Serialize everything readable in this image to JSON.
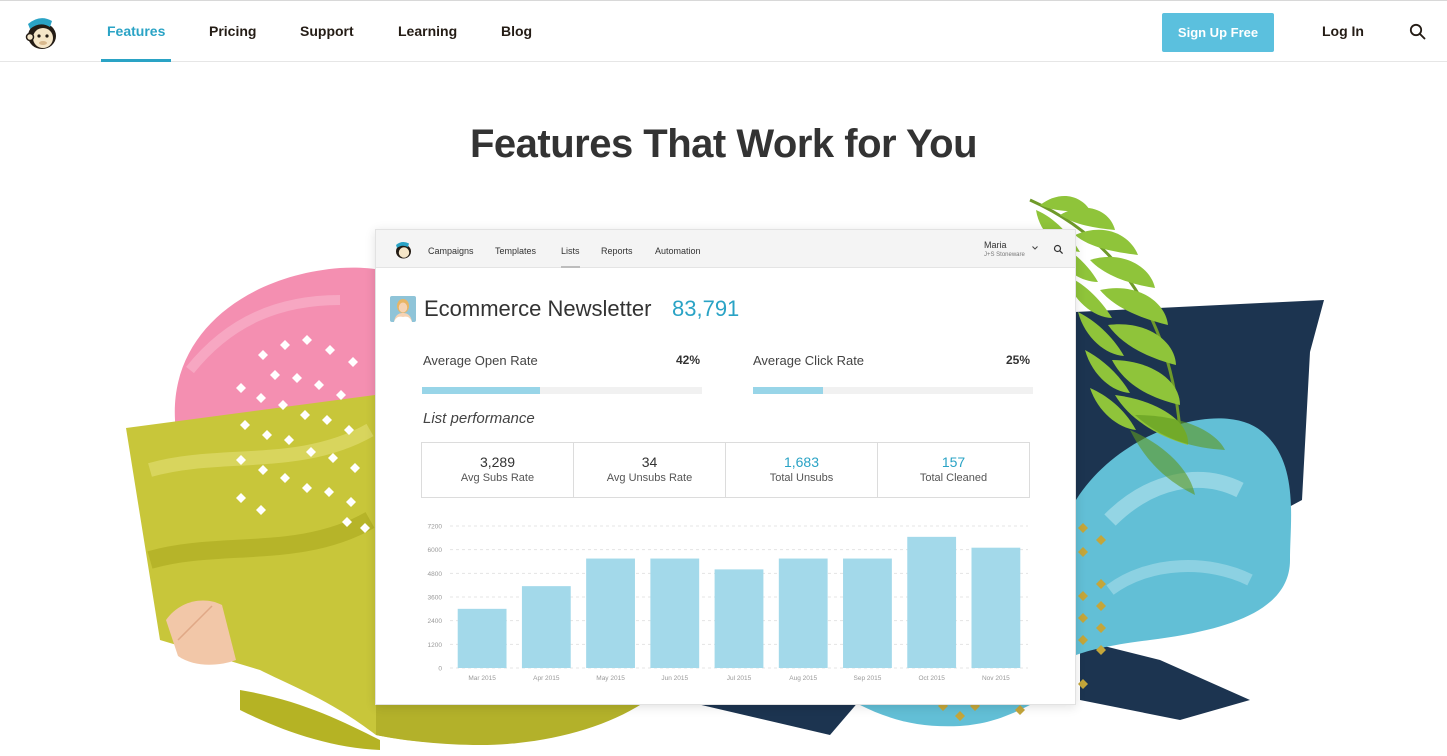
{
  "nav": {
    "links": [
      "Features",
      "Pricing",
      "Support",
      "Learning",
      "Blog"
    ],
    "active": "Features",
    "signup_label": "Sign Up Free",
    "login_label": "Log In"
  },
  "hero": {
    "title": "Features That Work for You"
  },
  "app": {
    "nav_items": [
      "Campaigns",
      "Templates",
      "Lists",
      "Reports",
      "Automation"
    ],
    "active_nav": "Lists",
    "user": {
      "name": "Maria",
      "org": "J+S Stoneware"
    },
    "list_name": "Ecommerce Newsletter",
    "list_count": "83,791",
    "open_rate": {
      "label": "Average Open Rate",
      "value": "42%",
      "fraction": 0.42
    },
    "click_rate": {
      "label": "Average Click Rate",
      "value": "25%",
      "fraction": 0.25
    },
    "performance_title": "List performance",
    "stats": [
      {
        "value": "3,289",
        "label": "Avg Subs Rate",
        "highlight": false
      },
      {
        "value": "34",
        "label": "Avg Unsubs Rate",
        "highlight": false
      },
      {
        "value": "1,683",
        "label": "Total Unsubs",
        "highlight": true
      },
      {
        "value": "157",
        "label": "Total Cleaned",
        "highlight": true
      }
    ]
  },
  "colors": {
    "accent": "#2aa3c5",
    "button": "#5bc0de",
    "bar": "#a3d9ea"
  },
  "chart_data": {
    "type": "bar",
    "categories": [
      "Mar 2015",
      "Apr 2015",
      "May 2015",
      "Jun 2015",
      "Jul 2015",
      "Aug 2015",
      "Sep 2015",
      "Oct 2015",
      "Nov 2015"
    ],
    "values": [
      3000,
      4150,
      5550,
      5550,
      5000,
      5550,
      5550,
      6650,
      6100
    ],
    "yticks": [
      "0",
      "1200",
      "2400",
      "3600",
      "4800",
      "6000",
      "7200"
    ],
    "ylim": [
      0,
      7200
    ],
    "grid": true
  }
}
